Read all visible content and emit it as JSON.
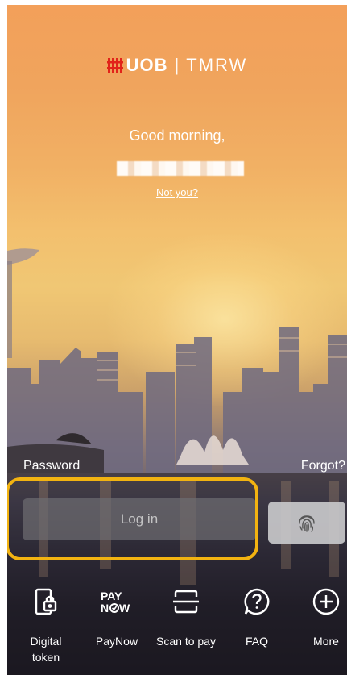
{
  "header": {
    "brand_logo_mark": "stripes-logo",
    "brand_name": "UOB",
    "brand_separator": "|",
    "brand_product": "TMRW",
    "accent_color": "#e2231a"
  },
  "greeting": {
    "text": "Good morning,",
    "username_hidden": true,
    "not_you_link": "Not you?"
  },
  "login_form": {
    "password_label": "Password",
    "forgot_link": "Forgot?",
    "login_button_label": "Log in",
    "fingerprint_icon": "fingerprint-icon",
    "highlight_color": "#f2b311"
  },
  "bottom_bar": {
    "items": [
      {
        "label": "Digital\ntoken",
        "icon": "phone-lock-icon"
      },
      {
        "label": "PayNow",
        "icon": "paynow-icon"
      },
      {
        "label": "Scan to pay",
        "icon": "scan-icon"
      },
      {
        "label": "FAQ",
        "icon": "help-circle-icon"
      },
      {
        "label": "More",
        "icon": "plus-circle-icon"
      }
    ]
  }
}
